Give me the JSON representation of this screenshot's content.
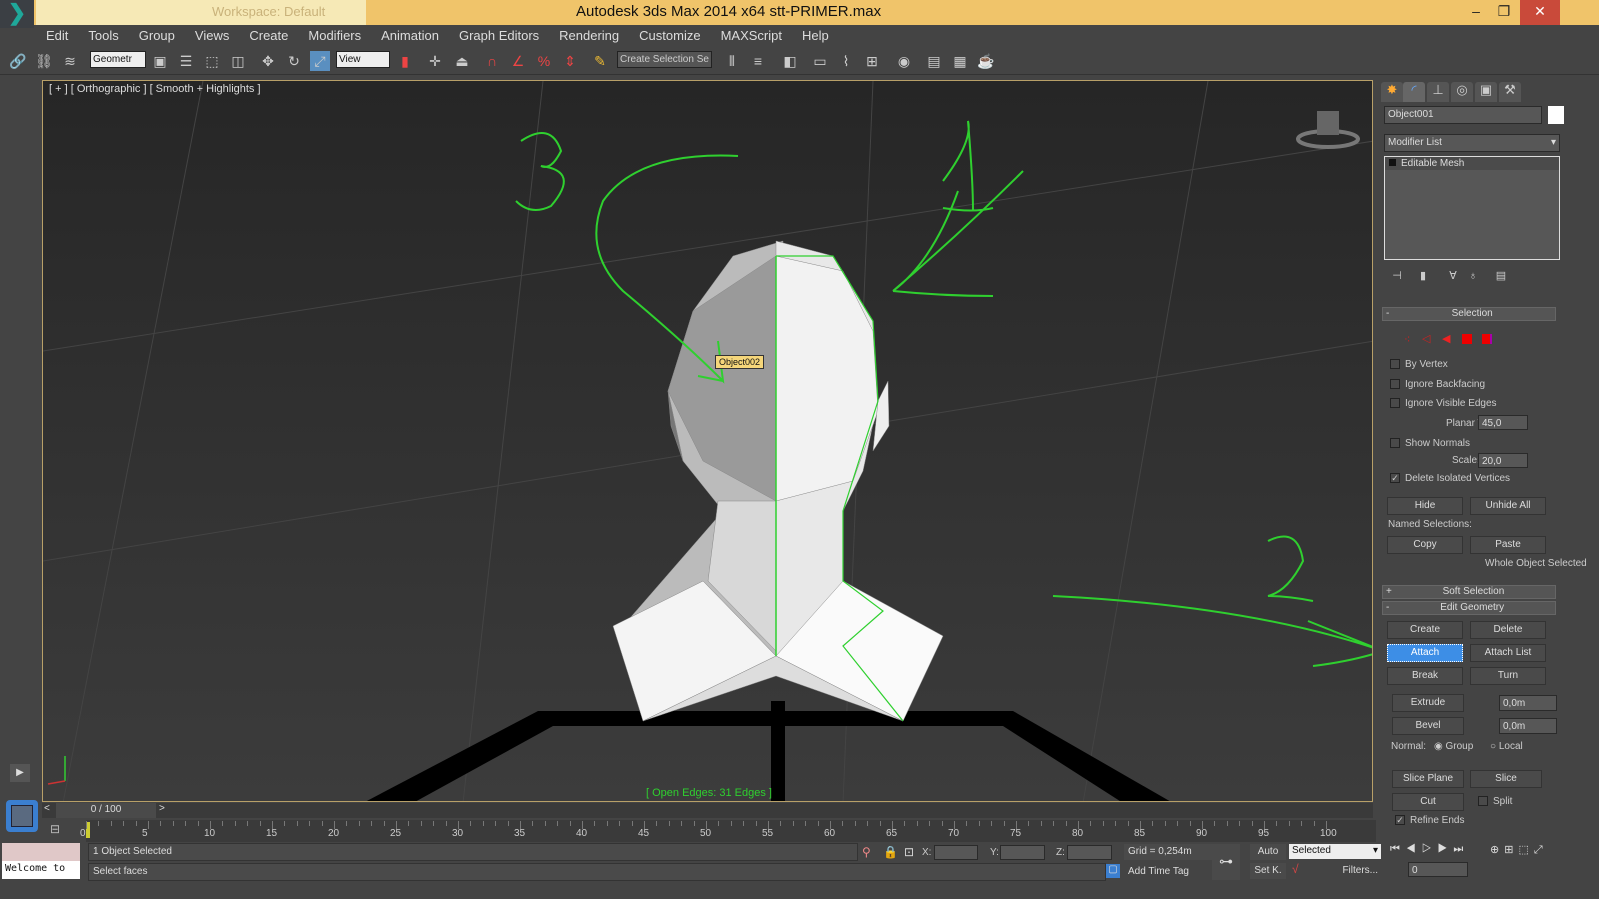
{
  "titlebar": {
    "workspace": "Workspace: Default",
    "title": "Autodesk 3ds Max  2014 x64      stt-PRIMER.max",
    "minimize": "–",
    "maximize": "❐",
    "close": "✕"
  },
  "menu": [
    "Edit",
    "Tools",
    "Group",
    "Views",
    "Create",
    "Modifiers",
    "Animation",
    "Graph Editors",
    "Rendering",
    "Customize",
    "MAXScript",
    "Help"
  ],
  "toolbar": {
    "selection_filter": "Geometr",
    "reference_coord": "View",
    "named_selection": "Create Selection Se"
  },
  "viewport": {
    "label": "[ + ] [ Orthographic ] [ Smooth + Highlights ]",
    "object_tooltip": "Object002",
    "status": "[ Open Edges: 31 Edges ]",
    "annotations": [
      "3",
      "1",
      "2"
    ]
  },
  "command_panel": {
    "object_name": "Object001",
    "object_color": "#ffffff",
    "modifier_list": "Modifier List",
    "stack": [
      "Editable Mesh"
    ],
    "selection": {
      "title": "Selection",
      "by_vertex": "By Vertex",
      "ignore_backfacing": "Ignore Backfacing",
      "ignore_visible_edges": "Ignore Visible Edges",
      "planar_thresh_label": "Planar Thresh:",
      "planar_thresh": "45,0",
      "show_normals": "Show Normals",
      "scale_label": "Scale:",
      "scale": "20,0",
      "delete_isolated": "Delete Isolated Vertices",
      "delete_isolated_checked": true,
      "hide": "Hide",
      "unhide_all": "Unhide All",
      "named_selections": "Named Selections:",
      "copy": "Copy",
      "paste": "Paste",
      "whole_object": "Whole Object Selected"
    },
    "soft_selection": "Soft Selection",
    "edit_geometry": {
      "title": "Edit Geometry",
      "create": "Create",
      "delete": "Delete",
      "attach": "Attach",
      "attach_list": "Attach List",
      "break": "Break",
      "turn": "Turn",
      "extrude": "Extrude",
      "extrude_val": "0,0m",
      "bevel": "Bevel",
      "bevel_val": "0,0m",
      "normal_label": "Normal:",
      "group": "Group",
      "local": "Local",
      "slice_plane": "Slice Plane",
      "slice": "Slice",
      "cut": "Cut",
      "split": "Split",
      "refine_ends": "Refine Ends"
    }
  },
  "timeline": {
    "frame": "0 / 100",
    "ticks": [
      "0",
      "5",
      "10",
      "15",
      "20",
      "25",
      "30",
      "35",
      "40",
      "45",
      "50",
      "55",
      "60",
      "65",
      "70",
      "75",
      "80",
      "85",
      "90",
      "95",
      "100"
    ]
  },
  "status": {
    "selected": "1 Object Selected",
    "prompt": "Select faces",
    "x_label": "X:",
    "y_label": "Y:",
    "z_label": "Z:",
    "grid": "Grid = 0,254m",
    "add_time_tag": "Add Time Tag",
    "auto": "Auto",
    "set_key": "Set K.",
    "key_filter": "Selected",
    "filters": "Filters...",
    "frame_field": "0",
    "maxscript": "Welcome to"
  },
  "colors": {
    "accent": "#3d8ee6",
    "title_bar": "#f0c46a",
    "annotation": "#2fd02f"
  }
}
